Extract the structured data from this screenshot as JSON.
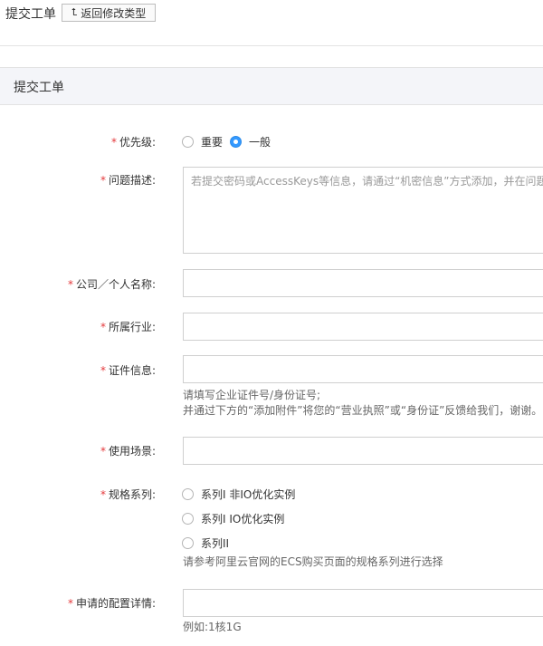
{
  "header": {
    "title": "提交工单",
    "back_button": "返回修改类型"
  },
  "panel": {
    "title": "提交工单"
  },
  "form": {
    "priority": {
      "label": "优先级:",
      "options": [
        "重要",
        "一般"
      ],
      "selected": "一般"
    },
    "description": {
      "label": "问题描述:",
      "placeholder": "若提交密码或AccessKeys等信息，请通过“机密信息”方式添加，并在问题处"
    },
    "company": {
      "label": "公司／个人名称:",
      "value": ""
    },
    "industry": {
      "label": "所属行业:",
      "value": ""
    },
    "certificate": {
      "label": "证件信息:",
      "value": "",
      "hint_line1": "请填写企业证件号/身份证号;",
      "hint_line2": "并通过下方的“添加附件”将您的“营业执照”或“身份证”反馈给我们，谢谢。"
    },
    "scenario": {
      "label": "使用场景:",
      "value": ""
    },
    "spec_series": {
      "label": "规格系列:",
      "options": [
        "系列I 非IO优化实例",
        "系列I IO优化实例",
        "系列II"
      ],
      "hint": "请参考阿里云官网的ECS购买页面的规格系列进行选择"
    },
    "config": {
      "label": "申请的配置详情:",
      "value": "",
      "hint": "例如:1核1G"
    }
  },
  "colors": {
    "required": "#e4393c",
    "accent": "#3399ff",
    "panel_bg": "#f4f5f9"
  }
}
